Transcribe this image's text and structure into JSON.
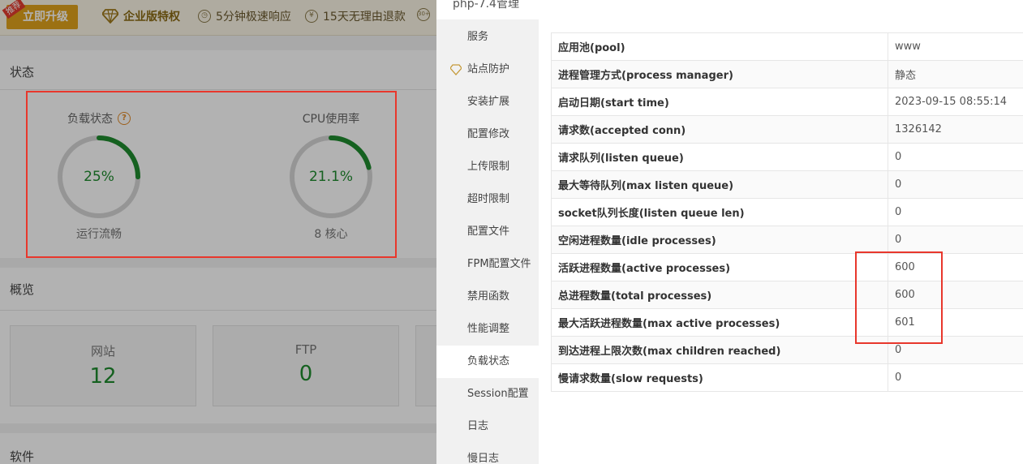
{
  "topbar": {
    "upgrade_label": "立即升级",
    "ribbon": "推荐",
    "items": [
      {
        "label": "企业版特权"
      },
      {
        "label": "5分钟极速响应"
      },
      {
        "label": "15天无理由退款"
      },
      {
        "label": "30+"
      }
    ]
  },
  "status": {
    "title": "状态",
    "load": {
      "label": "负载状态",
      "help_glyph": "?",
      "value_text": "25%",
      "value": 25,
      "sub": "运行流畅"
    },
    "cpu": {
      "label": "CPU使用率",
      "value_text": "21.1%",
      "value": 21.1,
      "sub": "8 核心"
    }
  },
  "overview": {
    "title": "概览",
    "cards": [
      {
        "label": "网站",
        "count": "12"
      },
      {
        "label": "FTP",
        "count": "0"
      }
    ]
  },
  "software": {
    "title": "软件"
  },
  "dialog": {
    "title": "php-7.4管理",
    "nav": [
      {
        "label": "服务"
      },
      {
        "label": "站点防护"
      },
      {
        "label": "安装扩展"
      },
      {
        "label": "配置修改"
      },
      {
        "label": "上传限制"
      },
      {
        "label": "超时限制"
      },
      {
        "label": "配置文件"
      },
      {
        "label": "FPM配置文件"
      },
      {
        "label": "禁用函数"
      },
      {
        "label": "性能调整"
      },
      {
        "label": "负载状态"
      },
      {
        "label": "Session配置"
      },
      {
        "label": "日志"
      },
      {
        "label": "慢日志"
      }
    ],
    "active_nav": "负载状态",
    "rows": [
      {
        "key": "应用池(pool)",
        "value": "www"
      },
      {
        "key": "进程管理方式(process manager)",
        "value": "静态"
      },
      {
        "key": "启动日期(start time)",
        "value": "2023-09-15 08:55:14"
      },
      {
        "key": "请求数(accepted conn)",
        "value": "1326142"
      },
      {
        "key": "请求队列(listen queue)",
        "value": "0"
      },
      {
        "key": "最大等待队列(max listen queue)",
        "value": "0"
      },
      {
        "key": "socket队列长度(listen queue len)",
        "value": "0"
      },
      {
        "key": "空闲进程数量(idle processes)",
        "value": "0"
      },
      {
        "key": "活跃进程数量(active processes)",
        "value": "600"
      },
      {
        "key": "总进程数量(total processes)",
        "value": "600"
      },
      {
        "key": "最大活跃进程数量(max active processes)",
        "value": "601"
      },
      {
        "key": "到达进程上限次数(max children reached)",
        "value": "0"
      },
      {
        "key": "慢请求数量(slow requests)",
        "value": "0"
      }
    ]
  },
  "colors": {
    "accent_green": "#1f8b2e",
    "highlight_red": "#e8372c",
    "upgrade_gold": "#e0a21c"
  },
  "icons": [
    "diamond-icon",
    "clock-icon",
    "refund-icon",
    "help-icon"
  ]
}
